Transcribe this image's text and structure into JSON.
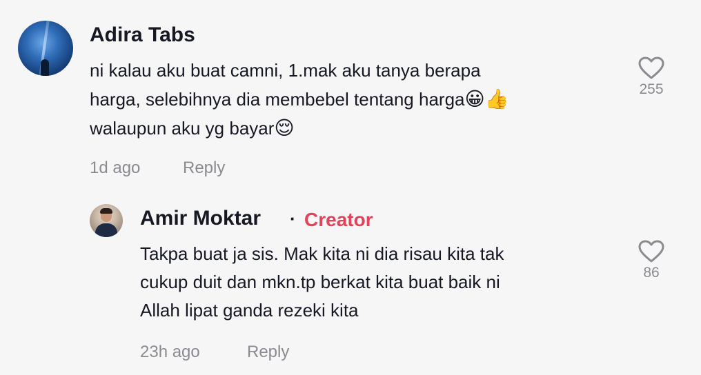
{
  "comment": {
    "author": "Adira Tabs",
    "text_lines": [
      "ni kalau aku buat camni, 1.mak aku tanya berapa",
      "harga, selebihnya dia membebel tentang harga",
      "walaupun aku yg bayar"
    ],
    "emoji_line2": "😀👍",
    "emoji_line3": "😌",
    "time": "1d ago",
    "reply_label": "Reply",
    "likes": "255"
  },
  "reply": {
    "author": "Amir Moktar",
    "separator": "·",
    "badge": "Creator",
    "text_lines": [
      "Takpa buat ja sis. Mak kita ni dia risau kita tak",
      "cukup duit dan mkn.tp berkat kita buat baik ni",
      "Allah lipat ganda rezeki kita"
    ],
    "time": "23h ago",
    "reply_label": "Reply",
    "likes": "86"
  },
  "icons": {
    "like": "heart-outline-icon"
  },
  "colors": {
    "creator": "#e2435a",
    "muted": "#8a8b91",
    "text": "#161823",
    "background": "#f6f6f6"
  }
}
